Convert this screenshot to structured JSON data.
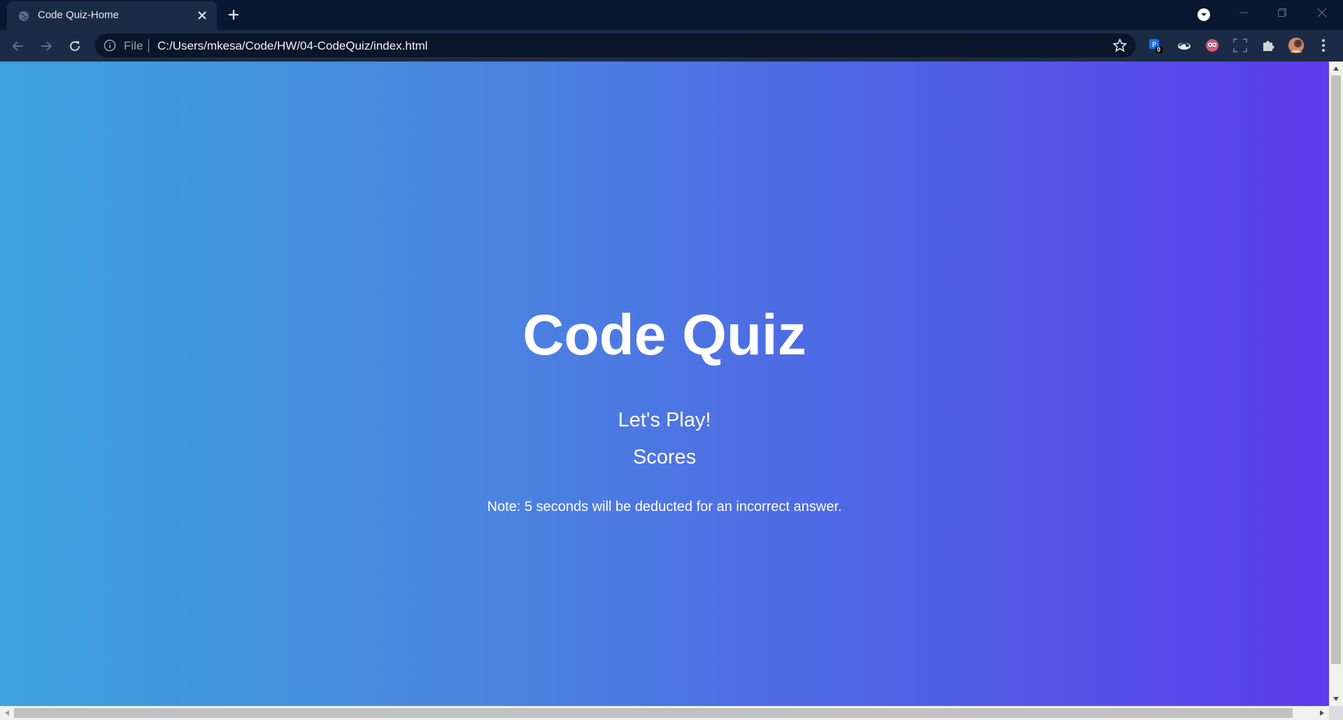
{
  "browser": {
    "tab_title": "Code Quiz-Home",
    "file_label": "File",
    "url": "C:/Users/mkesa/Code/HW/04-CodeQuiz/index.html",
    "extension_badge": "0",
    "icons": [
      "globe-icon",
      "close-icon",
      "plus-icon",
      "tab-search-icon",
      "minimize-icon",
      "restore-icon",
      "window-close-icon",
      "back-arrow-icon",
      "forward-arrow-icon",
      "reload-icon",
      "info-icon",
      "star-icon",
      "extension-icon",
      "puzzle-icon",
      "profile-avatar",
      "menu-dots-icon"
    ]
  },
  "page": {
    "title": "Code Quiz",
    "play_link": "Let's Play!",
    "scores_link": "Scores",
    "note": "Note: 5 seconds will be deducted for an incorrect answer."
  },
  "colors": {
    "gradient_start": "#3ca2dc",
    "gradient_end": "#5d3bec",
    "chrome_dark": "#091830",
    "toolbar": "#1c2b45"
  }
}
